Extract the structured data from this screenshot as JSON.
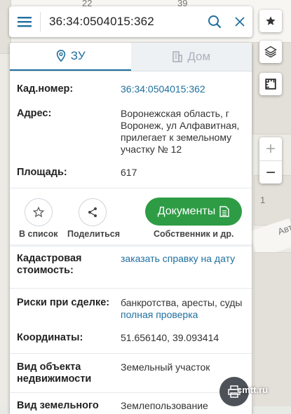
{
  "search": {
    "query": "36:34:0504015:362"
  },
  "map": {
    "labels": [
      "22",
      "39",
      "1",
      "Авт"
    ]
  },
  "tabs": [
    {
      "label": "ЗУ",
      "icon": "location-pin-icon",
      "active": true
    },
    {
      "label": "Дом",
      "icon": "building-icon",
      "active": false
    }
  ],
  "fields": {
    "cadnum": {
      "label": "Кад.номер:",
      "value": "36:34:0504015:362"
    },
    "address": {
      "label": "Адрес:",
      "value": "Воронежская область, г Воронеж, ул Алфавитная, прилегает к земельному участку № 12"
    },
    "area": {
      "label": "Площадь:",
      "value": "617"
    }
  },
  "actions": {
    "to_list": "В список",
    "share": "Поделиться",
    "documents": "Документы",
    "owner": "Собственник и др."
  },
  "details": {
    "cost": {
      "label": "Кадастровая стоимость:",
      "value": "заказать справку на дату"
    },
    "risks": {
      "label": "Риски при сделке:",
      "value": "банкротства, аресты, суды",
      "link": "полная проверка"
    },
    "coords": {
      "label": "Координаты:",
      "value": "51.656140, 39.093414"
    },
    "objtype": {
      "label": "Вид объекта недвижимости",
      "value": "Земельный участок"
    },
    "landtype": {
      "label": "Вид земельного участка",
      "value": "Землепользование"
    }
  },
  "watermark": "cmtt.ru",
  "colors": {
    "accent": "#1f6f9e",
    "green": "#2e9c45"
  }
}
